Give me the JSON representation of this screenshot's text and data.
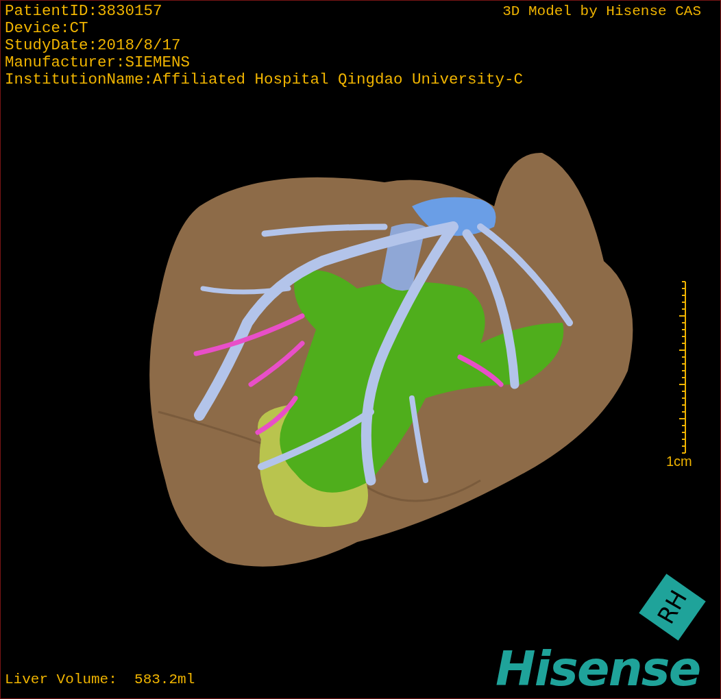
{
  "overlay_info": [
    "PatientID:3830157",
    "Device:CT",
    "StudyDate:2018/8/17",
    "Manufacturer:SIEMENS",
    "InstitutionName:Affiliated Hospital Qingdao University-C"
  ],
  "model_credit": "3D Model by Hisense CAS",
  "scale_bar": {
    "label": "1cm"
  },
  "liver_volume": "Liver Volume:  583.2ml",
  "logo": {
    "badge": "RH",
    "wordmark": "Hisense"
  }
}
